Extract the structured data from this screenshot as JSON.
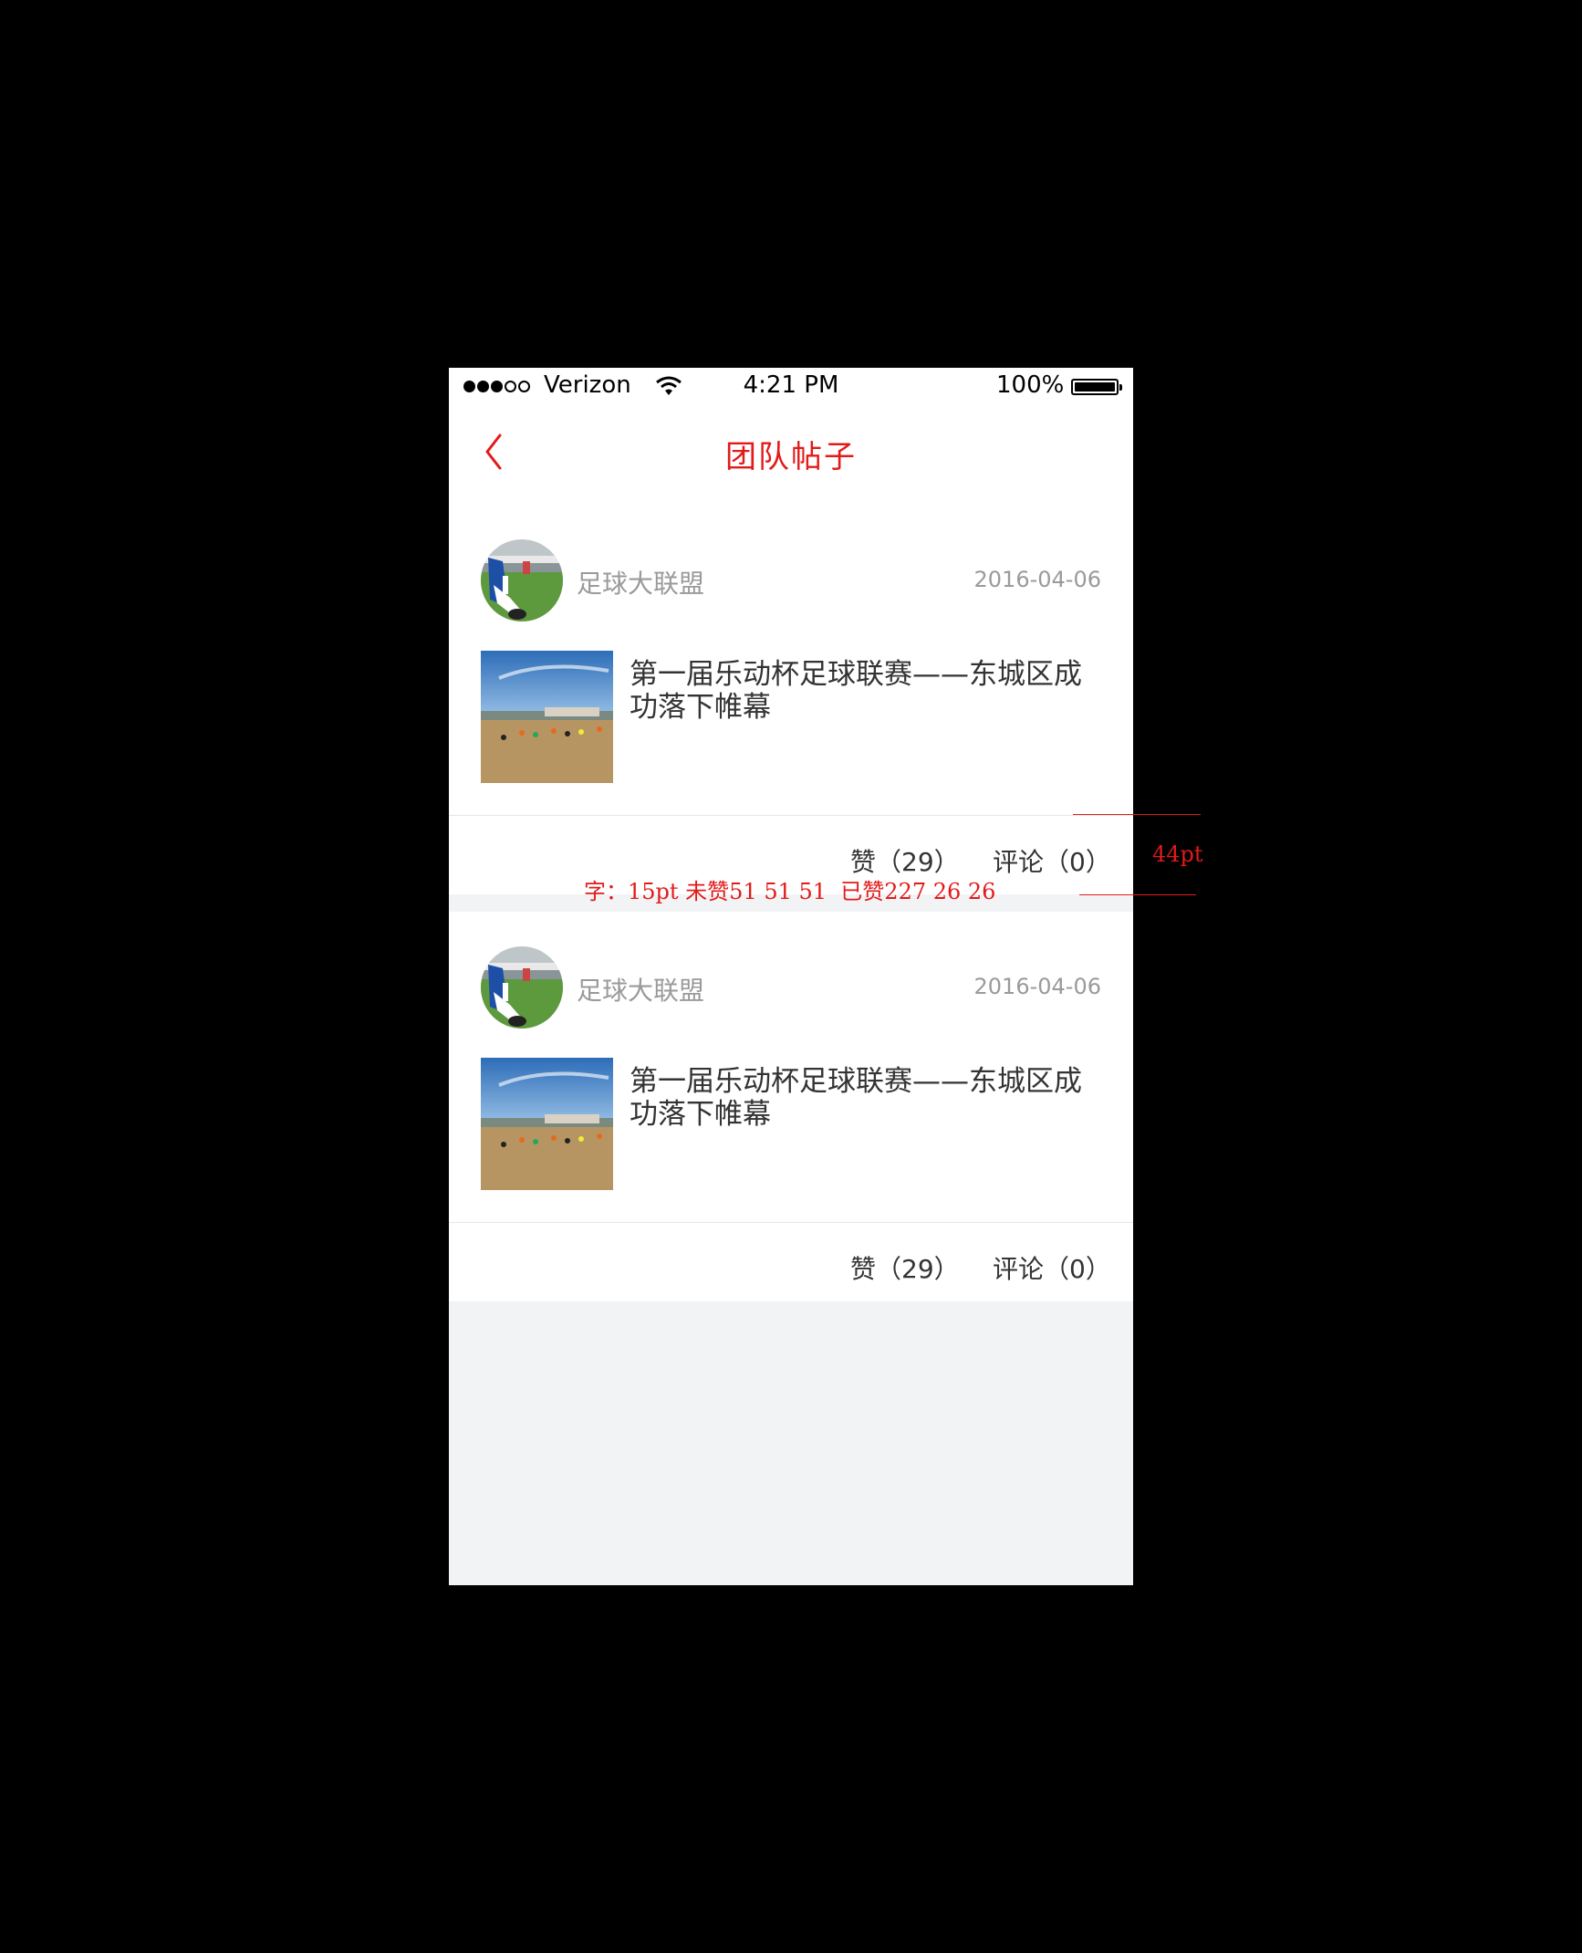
{
  "status_bar": {
    "carrier": "Verizon",
    "time": "4:21 PM",
    "battery": "100%"
  },
  "nav": {
    "title": "团队帖子"
  },
  "posts": [
    {
      "author": "足球大联盟",
      "date": "2016-04-06",
      "title": "第一届乐动杯足球联赛——东城区成功落下帷幕",
      "like_label": "赞（29）",
      "comment_label": "评论（0）"
    },
    {
      "author": "足球大联盟",
      "date": "2016-04-06",
      "title": "第一届乐动杯足球联赛——东城区成功落下帷幕",
      "like_label": "赞（29）",
      "comment_label": "评论（0）"
    }
  ],
  "annotations": {
    "height": "44pt",
    "font_spec": "字：15pt 未赞51 51 51  已赞227 26 26"
  },
  "colors": {
    "accent": "#e31a1a",
    "background": "#f2f3f5",
    "text_dark": "#333333",
    "text_muted": "#9a9a9a"
  }
}
